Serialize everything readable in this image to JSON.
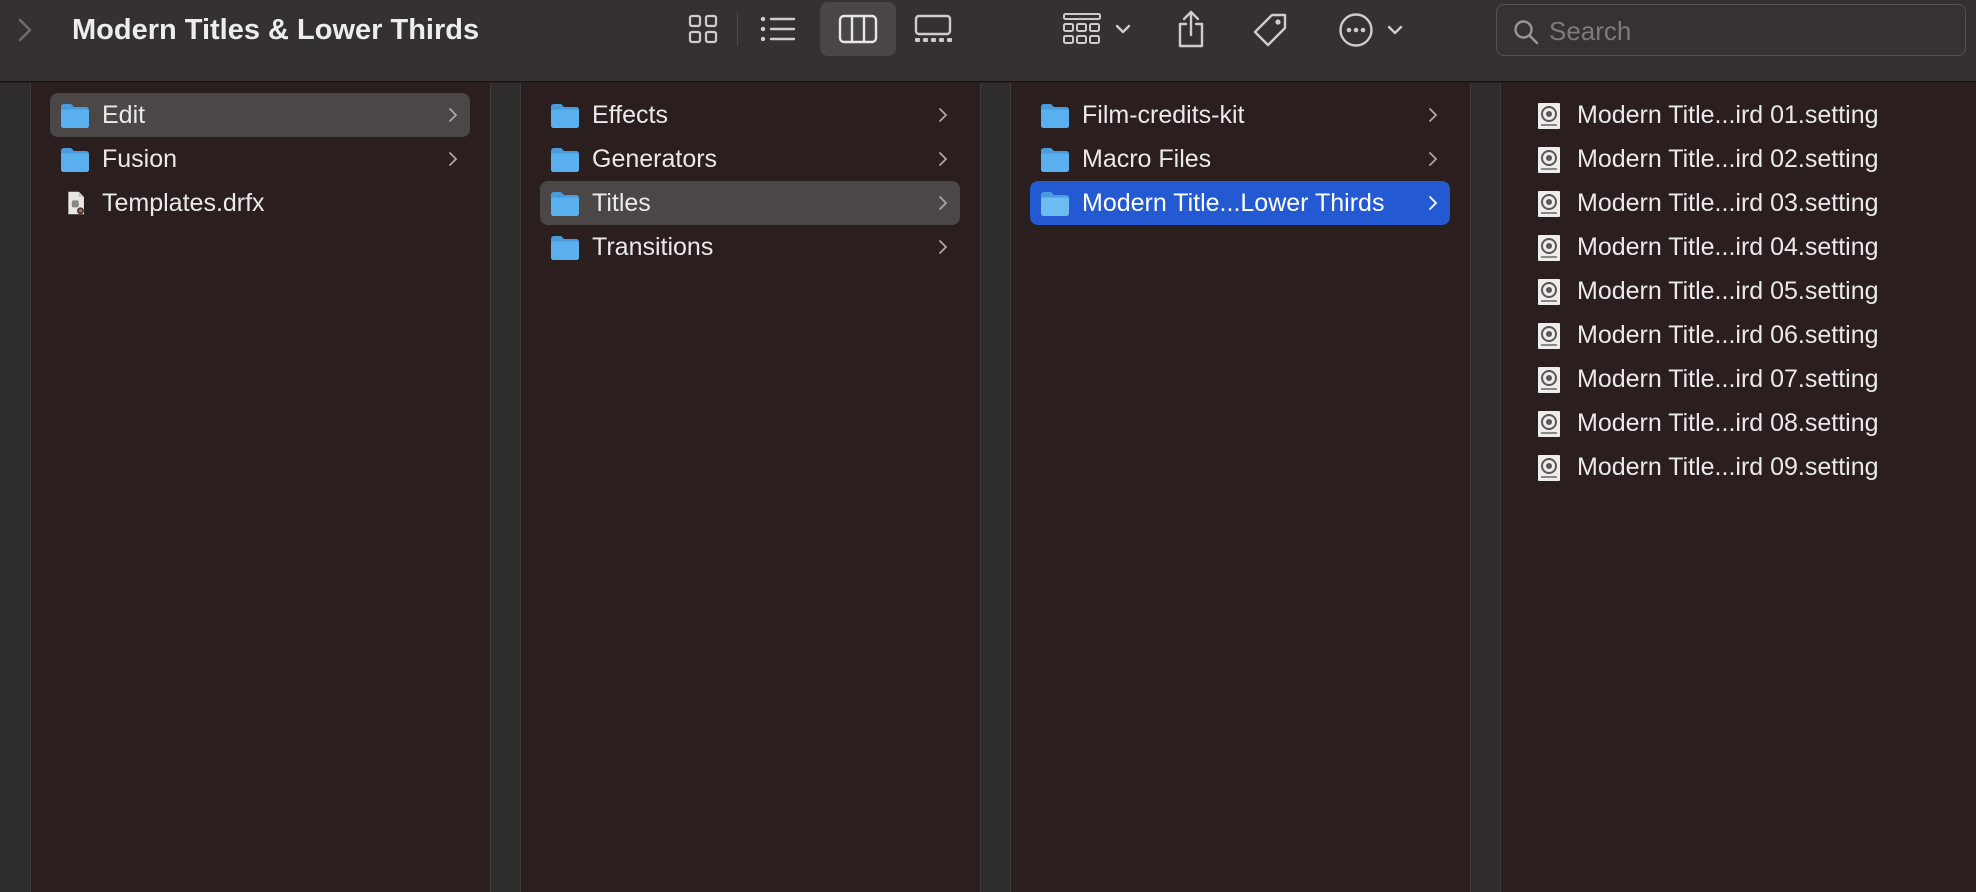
{
  "window": {
    "title": "Modern Titles & Lower Thirds"
  },
  "toolbar": {
    "search_placeholder": "Search",
    "icons": [
      "chevron-back-icon",
      "icon-view-icon",
      "list-view-icon",
      "column-view-icon",
      "gallery-view-icon",
      "group-icon",
      "chevron-down-icon",
      "share-icon",
      "tag-icon",
      "more-icon"
    ],
    "active_view": "column"
  },
  "colors": {
    "selection_blue": "#2359d1",
    "selection_gray": "#4b4747",
    "folder_blue": "#5ab0ee",
    "background": "#2a1f1e"
  },
  "columns": [
    {
      "items": [
        {
          "label": "Edit",
          "type": "folder",
          "state": "path"
        },
        {
          "label": "Fusion",
          "type": "folder",
          "state": ""
        },
        {
          "label": "Templates.drfx",
          "type": "file",
          "state": ""
        }
      ]
    },
    {
      "items": [
        {
          "label": "Effects",
          "type": "folder",
          "state": ""
        },
        {
          "label": "Generators",
          "type": "folder",
          "state": ""
        },
        {
          "label": "Titles",
          "type": "folder",
          "state": "path"
        },
        {
          "label": "Transitions",
          "type": "folder",
          "state": ""
        }
      ]
    },
    {
      "items": [
        {
          "label": "Film-credits-kit",
          "type": "folder",
          "state": ""
        },
        {
          "label": "Macro Files",
          "type": "folder",
          "state": ""
        },
        {
          "label": "Modern Title...Lower Thirds",
          "type": "folder",
          "state": "selected"
        }
      ]
    },
    {
      "items": [
        {
          "label": "Modern Title...ird 01.setting",
          "type": "setting"
        },
        {
          "label": "Modern Title...ird 02.setting",
          "type": "setting"
        },
        {
          "label": "Modern Title...ird 03.setting",
          "type": "setting"
        },
        {
          "label": "Modern Title...ird 04.setting",
          "type": "setting"
        },
        {
          "label": "Modern Title...ird 05.setting",
          "type": "setting"
        },
        {
          "label": "Modern Title...ird 06.setting",
          "type": "setting"
        },
        {
          "label": "Modern Title...ird 07.setting",
          "type": "setting"
        },
        {
          "label": "Modern Title...ird 08.setting",
          "type": "setting"
        },
        {
          "label": "Modern Title...ird 09.setting",
          "type": "setting"
        }
      ]
    }
  ]
}
